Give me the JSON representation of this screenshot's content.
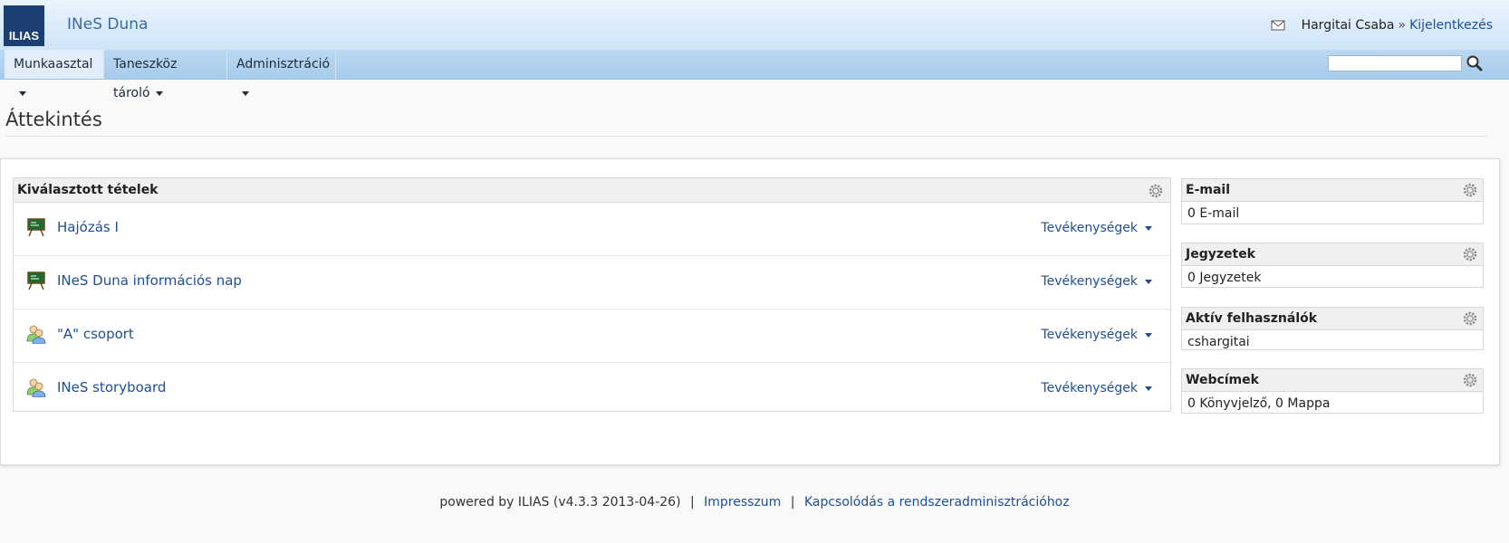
{
  "header": {
    "logo_text": "ILIAS",
    "site_title": "INeS Duna",
    "user_name": "Hargitai Csaba",
    "separator": "»",
    "logout_label": "Kijelentkezés"
  },
  "nav": {
    "items": [
      {
        "label": "Munkaasztal",
        "active": true
      },
      {
        "label": "Taneszköz tároló",
        "active": false
      },
      {
        "label": "Adminisztráció",
        "active": false
      }
    ],
    "search_value": ""
  },
  "page": {
    "title": "Áttekintés"
  },
  "selected_items": {
    "title": "Kiválasztott tételek",
    "items": [
      {
        "title": "Hajózás I",
        "icon": "course-icon",
        "actions_label": "Tevékenységek"
      },
      {
        "title": "INeS Duna információs nap",
        "icon": "course-icon",
        "actions_label": "Tevékenységek"
      },
      {
        "title": "\"A\" csoport",
        "icon": "group-icon",
        "actions_label": "Tevékenységek"
      },
      {
        "title": "INeS storyboard",
        "icon": "group-icon",
        "actions_label": "Tevékenységek"
      }
    ]
  },
  "side_blocks": {
    "email": {
      "title": "E-mail",
      "body": "0 E-mail"
    },
    "notes": {
      "title": "Jegyzetek",
      "body": "0 Jegyzetek"
    },
    "active_users": {
      "title": "Aktív felhasználók",
      "body": "cshargitai"
    },
    "bookmarks": {
      "title": "Webcímek",
      "body": "0 Könyvjelző, 0 Mappa"
    }
  },
  "footer": {
    "powered_text": "powered by ILIAS (v4.3.3 2013-04-26)",
    "pipe": "|",
    "imprint_label": "Impresszum",
    "contact_label": "Kapcsolódás a rendszeradminisztrációhoz"
  },
  "colors": {
    "link": "#1d4e9b",
    "header_top": "#eaf4fd",
    "nav_bg": "#a7cbec",
    "logo_bg": "#1b3f73"
  }
}
